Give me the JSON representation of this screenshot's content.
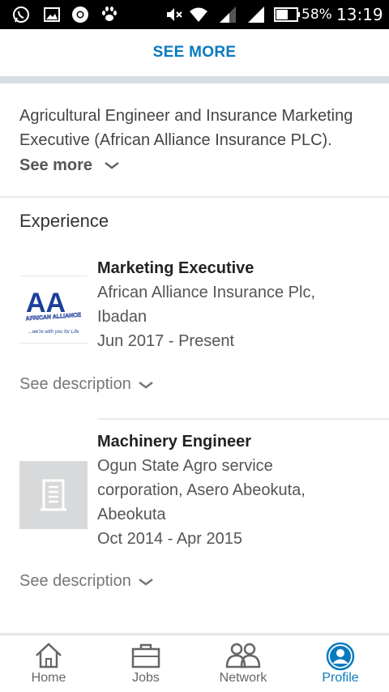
{
  "status_bar": {
    "battery_percent": "58%",
    "time": "13:19",
    "icons": [
      "whatsapp-icon",
      "gallery-icon",
      "chrome-icon",
      "paw-icon",
      "mute-icon",
      "wifi-icon",
      "signal-icon",
      "signal-icon",
      "battery-icon"
    ]
  },
  "top": {
    "see_more_label": "SEE MORE"
  },
  "summary": {
    "text": "Agricultural Engineer and Insurance Marketing Executive (African Alliance Insurance PLC).",
    "see_more_label": "See more"
  },
  "experience": {
    "title": "Experience",
    "items": [
      {
        "title": "Marketing Executive",
        "company_line1": "African Alliance Insurance Plc,",
        "company_line2": "Ibadan",
        "dates": "Jun 2017 - Present",
        "see_description": "See description",
        "logo": {
          "letters": "AA",
          "banner": "AFRICAN ALLIANCE",
          "tagline": "...we're with you for Life"
        }
      },
      {
        "title": "Machinery Engineer",
        "company_line1": "Ogun State Agro service",
        "company_line2": "corporation, Asero Abeokuta,",
        "company_line3": "Abeokuta",
        "dates": "Oct 2014 - Apr 2015",
        "see_description": "See description"
      }
    ]
  },
  "bottom_nav": [
    {
      "label": "Home",
      "icon": "home-icon"
    },
    {
      "label": "Jobs",
      "icon": "briefcase-icon"
    },
    {
      "label": "Network",
      "icon": "network-icon"
    },
    {
      "label": "Profile",
      "icon": "profile-icon",
      "active": true
    }
  ],
  "colors": {
    "accent": "#0a7abf",
    "divider": "#d5dde5",
    "status_bar": "#000000"
  }
}
